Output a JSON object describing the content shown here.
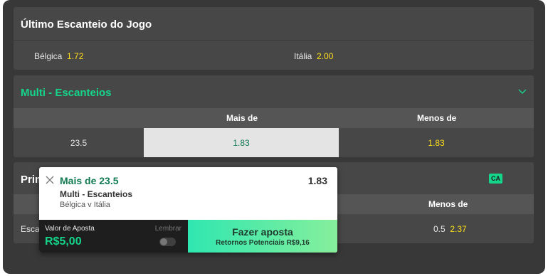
{
  "colors": {
    "background": "#383838",
    "card": "#474747",
    "accent_green": "#14d58a",
    "odds_yellow": "#ffdf1b",
    "selected_cell": "#e4e4e4"
  },
  "last_corner": {
    "title": "Último Escanteio do Jogo",
    "options": [
      {
        "team": "Bélgica",
        "odds": "1.72"
      },
      {
        "team": "Itália",
        "odds": "2.00"
      }
    ]
  },
  "multi_corners": {
    "title": "Multi - Escanteios",
    "icon": "chevron-down-icon",
    "columns": {
      "over": "Mais de",
      "under": "Menos de"
    },
    "row": {
      "line": "23.5",
      "over_odds": "1.83",
      "under_odds": "1.83"
    }
  },
  "third_card": {
    "title_partial": "Prim",
    "badge": "CA",
    "columns": {
      "under": "Menos de"
    },
    "row": {
      "line_partial": "Escar",
      "under_line": "0.5",
      "under_odds": "2.37"
    }
  },
  "bet_slip": {
    "close_icon": "close-icon",
    "selection": "Mais de 23.5",
    "odds": "1.83",
    "market": "Multi - Escanteios",
    "event": "Bélgica v Itália",
    "stake_label": "Valor de Aposta",
    "stake_value": "R$5,00",
    "remember_label": "Lembrar",
    "remember_on": false,
    "place_bet_label": "Fazer aposta",
    "potential_returns": "Retornos Potenciais R$9,16"
  }
}
